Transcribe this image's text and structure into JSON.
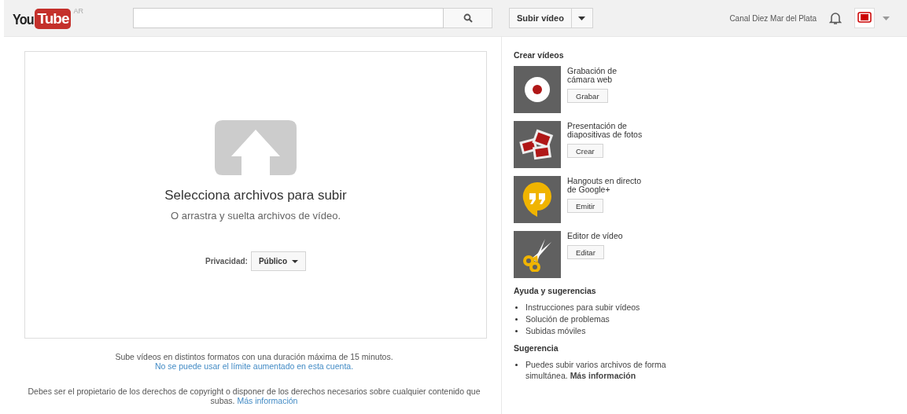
{
  "header": {
    "logo": {
      "you": "You",
      "tube": "Tube",
      "country": "AR"
    },
    "upload_button": "Subir vídeo",
    "channel_name": "Canal Diez Mar del Plata"
  },
  "upload": {
    "title": "Selecciona archivos para subir",
    "subtitle": "O arrastra y suelta archivos de vídeo.",
    "privacy_label": "Privacidad:",
    "privacy_value": "Público"
  },
  "notes": [
    {
      "text": "Sube vídeos en distintos formatos con una duración máxima de 15 minutos.",
      "link": "No se puede usar el límite aumentado en esta cuenta."
    },
    {
      "text": "Debes ser el propietario de los derechos de copyright o disponer de los derechos necesarios sobre cualquier contenido que subas.",
      "link": "Más información"
    }
  ],
  "sidebar": {
    "create_title": "Crear vídeos",
    "tools": [
      {
        "kind": "webcam",
        "label": "Grabación de cámara web",
        "button": "Grabar"
      },
      {
        "kind": "slideshow",
        "label": "Presentación de diapositivas de fotos",
        "button": "Crear"
      },
      {
        "kind": "hangouts",
        "label": "Hangouts en directo de Google+",
        "button": "Emitir"
      },
      {
        "kind": "editor",
        "label": "Editor de vídeo",
        "button": "Editar"
      }
    ],
    "help_title": "Ayuda y sugerencias",
    "help_links": [
      "Instrucciones para subir vídeos",
      "Solución de problemas",
      "Subidas móviles"
    ],
    "tip_title": "Sugerencia",
    "tip": "Puedes subir varios archivos de forma simultánea. **Más información**"
  }
}
